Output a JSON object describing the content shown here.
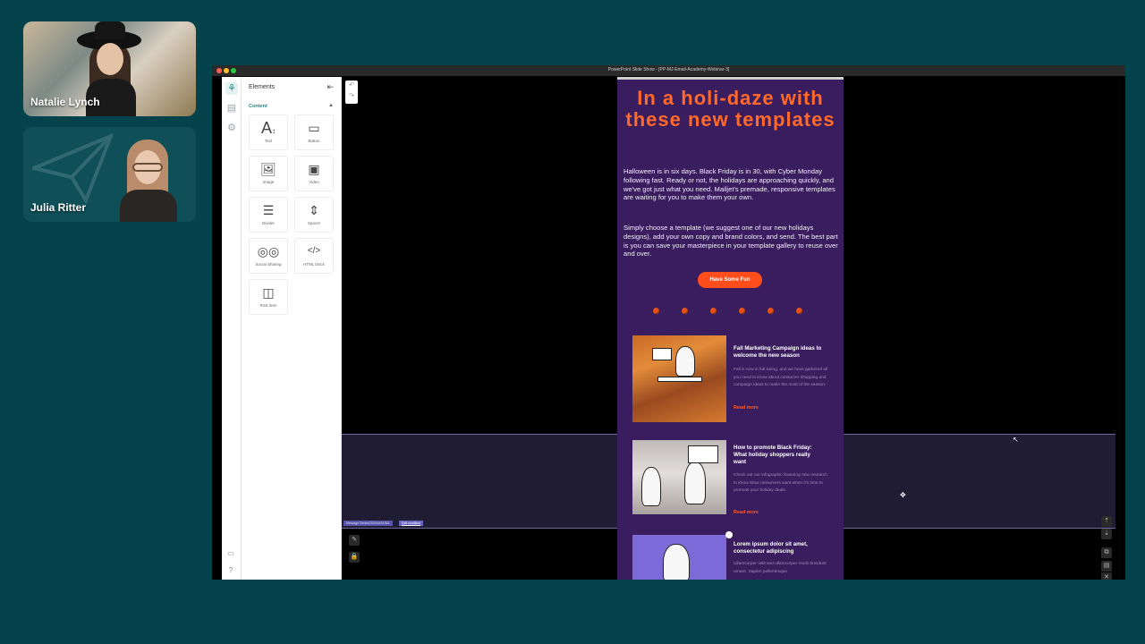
{
  "participants": [
    {
      "name": "Natalie Lynch"
    },
    {
      "name": "Julia Ritter"
    }
  ],
  "window": {
    "title": "PowerPoint Slide Show - [PP-MJ-Email-Academy-Webinar-3]"
  },
  "panel": {
    "title": "Elements",
    "section": "Content",
    "elements": [
      {
        "label": "Text",
        "icon": "text-icon"
      },
      {
        "label": "Button",
        "icon": "button-icon"
      },
      {
        "label": "Image",
        "icon": "image-icon"
      },
      {
        "label": "Video",
        "icon": "video-icon"
      },
      {
        "label": "Divider",
        "icon": "divider-icon"
      },
      {
        "label": "Spacer",
        "icon": "spacer-icon"
      },
      {
        "label": "Social Sharing",
        "icon": "social-icon"
      },
      {
        "label": "HTML block",
        "icon": "code-icon"
      },
      {
        "label": "RSS item",
        "icon": "rss-icon"
      }
    ]
  },
  "canvas": {
    "hover_tag": "Message Series/2024/UI/MJML",
    "hover_link": "Edit condition"
  },
  "email": {
    "headline": "In a holi-daze with these new templates",
    "paragraph1": "Halloween is in six days. Black Friday is in 30, with Cyber Monday following fast. Ready or not, the holidays are approaching quickly, and we've got just what you need. Mailjet's premade, responsive templates are waiting for you to make them your own.",
    "paragraph2": "Simply choose a template (we suggest one of our new holidays designs), add your own copy and brand colors, and send. The best part is you can save your masterpiece in your template gallery to reuse over and over.",
    "cta": "Have Some Fun",
    "articles": [
      {
        "title": "Fall Marketing Campaign ideas to welcome the new season",
        "body": "Fall is now in full swing, and we have gathered all you need to know about consumer shopping and campaign ideas to make the most of the season.",
        "link": "Read more"
      },
      {
        "title": "How to promote Black Friday: What holiday shoppers really want",
        "body": "Check out our infographic featuring new research to know what consumers want when it's time to promote your holiday deals.",
        "link": "Read more"
      },
      {
        "title": "Lorem ipsum dolor sit amet, consectetur adipiscing",
        "body": "Ullamcorper velit sed ullamcorper morbi tincidunt ornare. Sapien pellentesque",
        "link": ""
      }
    ]
  },
  "colors": {
    "background": "#05434c",
    "email_bg": "#3a1d5e",
    "accent_orange": "#ff6a2b",
    "cta": "#ff4d1c",
    "builder_teal": "#2c8c8c"
  }
}
